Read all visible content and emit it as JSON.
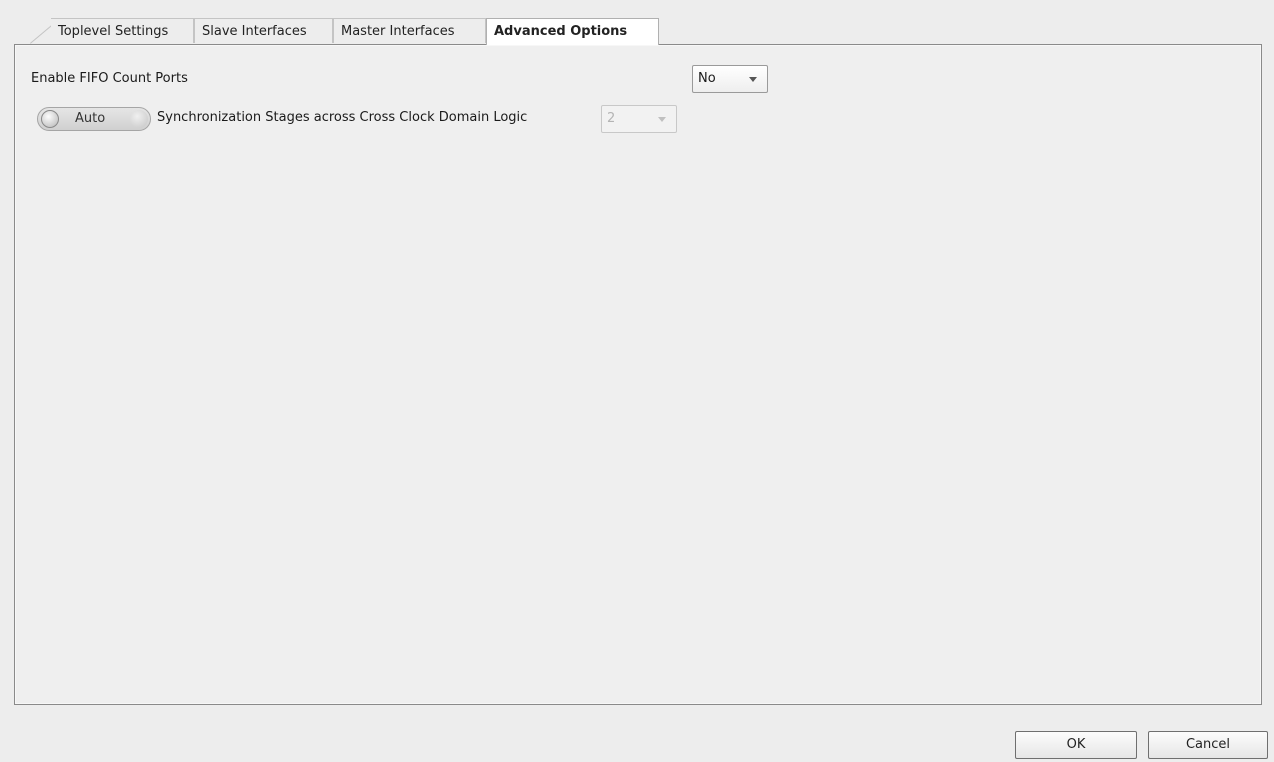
{
  "tabs": [
    {
      "label": "Toplevel Settings"
    },
    {
      "label": "Slave Interfaces"
    },
    {
      "label": "Master Interfaces"
    },
    {
      "label": "Advanced Options"
    }
  ],
  "options": {
    "fifo_count": {
      "label": "Enable FIFO Count Ports",
      "value": "No"
    },
    "sync_stages": {
      "toggle_label": "Auto",
      "label": "Synchronization Stages across Cross Clock Domain Logic",
      "value": "2"
    }
  },
  "footer": {
    "ok_label": "OK",
    "cancel_label": "Cancel"
  }
}
